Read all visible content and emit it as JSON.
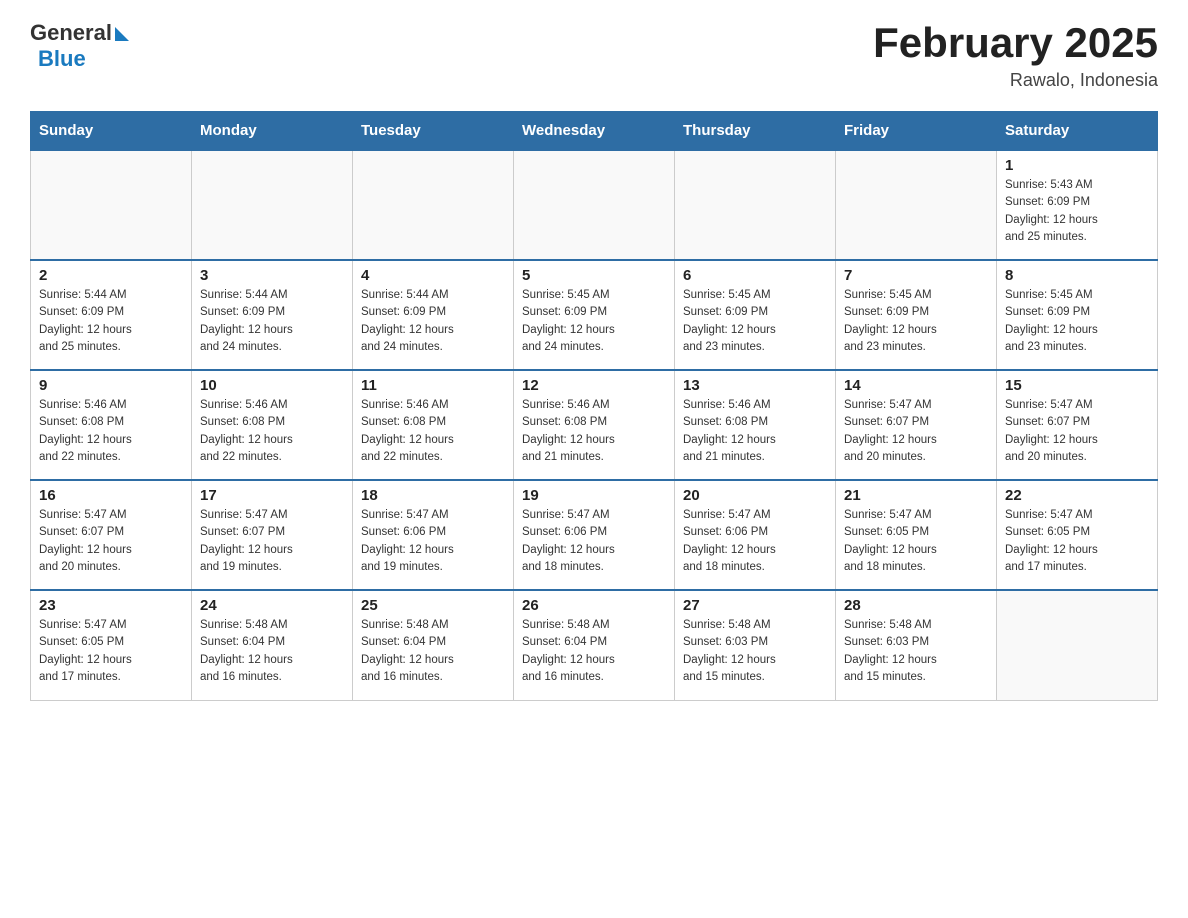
{
  "header": {
    "logo_general": "General",
    "logo_blue": "Blue",
    "title": "February 2025",
    "subtitle": "Rawalo, Indonesia"
  },
  "weekdays": [
    "Sunday",
    "Monday",
    "Tuesday",
    "Wednesday",
    "Thursday",
    "Friday",
    "Saturday"
  ],
  "weeks": [
    [
      {
        "day": "",
        "info": ""
      },
      {
        "day": "",
        "info": ""
      },
      {
        "day": "",
        "info": ""
      },
      {
        "day": "",
        "info": ""
      },
      {
        "day": "",
        "info": ""
      },
      {
        "day": "",
        "info": ""
      },
      {
        "day": "1",
        "info": "Sunrise: 5:43 AM\nSunset: 6:09 PM\nDaylight: 12 hours\nand 25 minutes."
      }
    ],
    [
      {
        "day": "2",
        "info": "Sunrise: 5:44 AM\nSunset: 6:09 PM\nDaylight: 12 hours\nand 25 minutes."
      },
      {
        "day": "3",
        "info": "Sunrise: 5:44 AM\nSunset: 6:09 PM\nDaylight: 12 hours\nand 24 minutes."
      },
      {
        "day": "4",
        "info": "Sunrise: 5:44 AM\nSunset: 6:09 PM\nDaylight: 12 hours\nand 24 minutes."
      },
      {
        "day": "5",
        "info": "Sunrise: 5:45 AM\nSunset: 6:09 PM\nDaylight: 12 hours\nand 24 minutes."
      },
      {
        "day": "6",
        "info": "Sunrise: 5:45 AM\nSunset: 6:09 PM\nDaylight: 12 hours\nand 23 minutes."
      },
      {
        "day": "7",
        "info": "Sunrise: 5:45 AM\nSunset: 6:09 PM\nDaylight: 12 hours\nand 23 minutes."
      },
      {
        "day": "8",
        "info": "Sunrise: 5:45 AM\nSunset: 6:09 PM\nDaylight: 12 hours\nand 23 minutes."
      }
    ],
    [
      {
        "day": "9",
        "info": "Sunrise: 5:46 AM\nSunset: 6:08 PM\nDaylight: 12 hours\nand 22 minutes."
      },
      {
        "day": "10",
        "info": "Sunrise: 5:46 AM\nSunset: 6:08 PM\nDaylight: 12 hours\nand 22 minutes."
      },
      {
        "day": "11",
        "info": "Sunrise: 5:46 AM\nSunset: 6:08 PM\nDaylight: 12 hours\nand 22 minutes."
      },
      {
        "day": "12",
        "info": "Sunrise: 5:46 AM\nSunset: 6:08 PM\nDaylight: 12 hours\nand 21 minutes."
      },
      {
        "day": "13",
        "info": "Sunrise: 5:46 AM\nSunset: 6:08 PM\nDaylight: 12 hours\nand 21 minutes."
      },
      {
        "day": "14",
        "info": "Sunrise: 5:47 AM\nSunset: 6:07 PM\nDaylight: 12 hours\nand 20 minutes."
      },
      {
        "day": "15",
        "info": "Sunrise: 5:47 AM\nSunset: 6:07 PM\nDaylight: 12 hours\nand 20 minutes."
      }
    ],
    [
      {
        "day": "16",
        "info": "Sunrise: 5:47 AM\nSunset: 6:07 PM\nDaylight: 12 hours\nand 20 minutes."
      },
      {
        "day": "17",
        "info": "Sunrise: 5:47 AM\nSunset: 6:07 PM\nDaylight: 12 hours\nand 19 minutes."
      },
      {
        "day": "18",
        "info": "Sunrise: 5:47 AM\nSunset: 6:06 PM\nDaylight: 12 hours\nand 19 minutes."
      },
      {
        "day": "19",
        "info": "Sunrise: 5:47 AM\nSunset: 6:06 PM\nDaylight: 12 hours\nand 18 minutes."
      },
      {
        "day": "20",
        "info": "Sunrise: 5:47 AM\nSunset: 6:06 PM\nDaylight: 12 hours\nand 18 minutes."
      },
      {
        "day": "21",
        "info": "Sunrise: 5:47 AM\nSunset: 6:05 PM\nDaylight: 12 hours\nand 18 minutes."
      },
      {
        "day": "22",
        "info": "Sunrise: 5:47 AM\nSunset: 6:05 PM\nDaylight: 12 hours\nand 17 minutes."
      }
    ],
    [
      {
        "day": "23",
        "info": "Sunrise: 5:47 AM\nSunset: 6:05 PM\nDaylight: 12 hours\nand 17 minutes."
      },
      {
        "day": "24",
        "info": "Sunrise: 5:48 AM\nSunset: 6:04 PM\nDaylight: 12 hours\nand 16 minutes."
      },
      {
        "day": "25",
        "info": "Sunrise: 5:48 AM\nSunset: 6:04 PM\nDaylight: 12 hours\nand 16 minutes."
      },
      {
        "day": "26",
        "info": "Sunrise: 5:48 AM\nSunset: 6:04 PM\nDaylight: 12 hours\nand 16 minutes."
      },
      {
        "day": "27",
        "info": "Sunrise: 5:48 AM\nSunset: 6:03 PM\nDaylight: 12 hours\nand 15 minutes."
      },
      {
        "day": "28",
        "info": "Sunrise: 5:48 AM\nSunset: 6:03 PM\nDaylight: 12 hours\nand 15 minutes."
      },
      {
        "day": "",
        "info": ""
      }
    ]
  ]
}
